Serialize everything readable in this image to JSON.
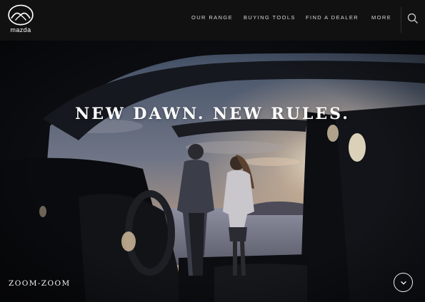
{
  "brand": {
    "wordmark": "mazda"
  },
  "nav": {
    "items": [
      {
        "label": "OUR RANGE"
      },
      {
        "label": "BUYING TOOLS"
      },
      {
        "label": "FIND A DEALER"
      },
      {
        "label": "MORE"
      }
    ],
    "search_icon": "search-icon"
  },
  "hero": {
    "title": "NEW DAWN. NEW RULES.",
    "tagline": "ZOOM-ZOOM",
    "scroll_icon": "chevron-down-icon"
  },
  "colors": {
    "header_bg": "#111111",
    "hero_text": "#ffffff",
    "nav_text": "#d8d8d8"
  }
}
